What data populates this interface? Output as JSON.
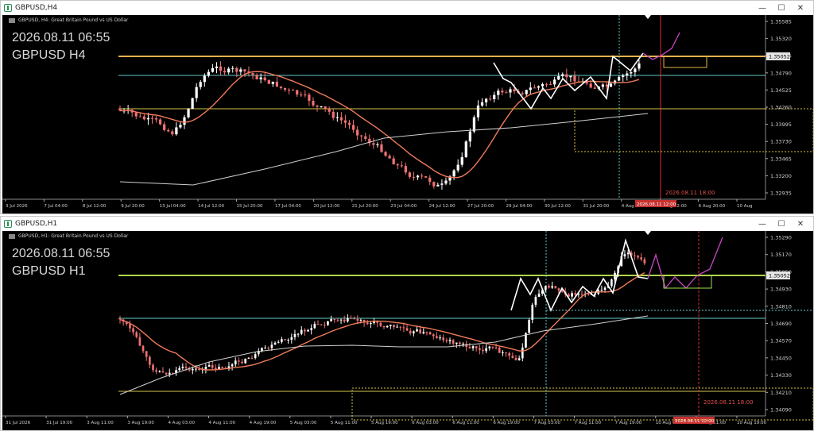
{
  "colors": {
    "background": "#000000",
    "bull": "#ffffff",
    "bear": "#f07171",
    "ma_fast": "#f07a5a",
    "ma_slow": "#cfcfcf",
    "level": "#e6b34a",
    "cyan": "#63c8c8",
    "yellow_line": "#d8c44a",
    "green_line": "#9ce14a",
    "magenta": "#c845c8",
    "time_line": "#d33434",
    "bid_label_bg": "#e6e6e6"
  },
  "top_window": {
    "title": "GBPUSD,H4",
    "header": "GBPUSD, H4:  Great Britain Pound vs US Dollar",
    "overlay_date": "2026.08.11 06:55",
    "overlay_symbol": "GBPUSD H4",
    "price_labels": [
      "1.35585",
      "1.35320",
      "1.35055",
      "1.34790",
      "1.34525",
      "1.34260",
      "1.33995",
      "1.33730",
      "1.33465",
      "1.33200",
      "1.32935"
    ],
    "current_price": "1.35052",
    "time_labels": [
      "3 Jul 2026",
      "7 Jul 04:00",
      "8 Jul 12:00",
      "9 Jul 20:00",
      "13 Jul 04:00",
      "14 Jul 12:00",
      "15 Jul 20:00",
      "17 Jul 04:00",
      "20 Jul 12:00",
      "21 Jul 20:00",
      "23 Jul 04:00",
      "24 Jul 12:00",
      "27 Jul 20:00",
      "29 Jul 04:00",
      "30 Jul 12:00",
      "31 Jul 20:00",
      "4 Aug 04:00",
      "5 Aug 12:00",
      "6 Aug 20:00",
      "10 Aug"
    ],
    "vline_label": "2026.08.11 18:00",
    "cursor_time_label": "2026.08.11 12:00"
  },
  "bottom_window": {
    "title": "GBPUSD,H1",
    "header": "GBPUSD, H1:  Great Britain Pound vs US Dollar",
    "overlay_date": "2026.08.11 06:55",
    "overlay_symbol": "GBPUSD H1",
    "price_labels": [
      "1.35290",
      "1.35170",
      "1.35050",
      "1.34930",
      "1.34810",
      "1.34690",
      "1.34570",
      "1.34450",
      "1.34330",
      "1.34210",
      "1.34090"
    ],
    "current_price": "1.35052",
    "time_labels": [
      "31 Jul 2026",
      "31 Jul 19:00",
      "3 Aug 11:00",
      "3 Aug 19:00",
      "4 Aug 03:00",
      "4 Aug 11:00",
      "4 Aug 19:00",
      "5 Aug 03:00",
      "5 Aug 11:00",
      "5 Aug 19:00",
      "6 Aug 03:00",
      "6 Aug 11:00",
      "6 Aug 19:00",
      "7 Aug 03:00",
      "7 Aug 11:00",
      "7 Aug 19:00",
      "10 Aug 03:00",
      "10 Aug 11:00",
      "10 Aug 19:00"
    ],
    "vline_label": "2026.08.11 18:00",
    "cursor_time_label": "2026.08.11 12:00"
  },
  "window_buttons": {
    "minimize": "—",
    "maximize": "☐",
    "close": "✕"
  }
}
